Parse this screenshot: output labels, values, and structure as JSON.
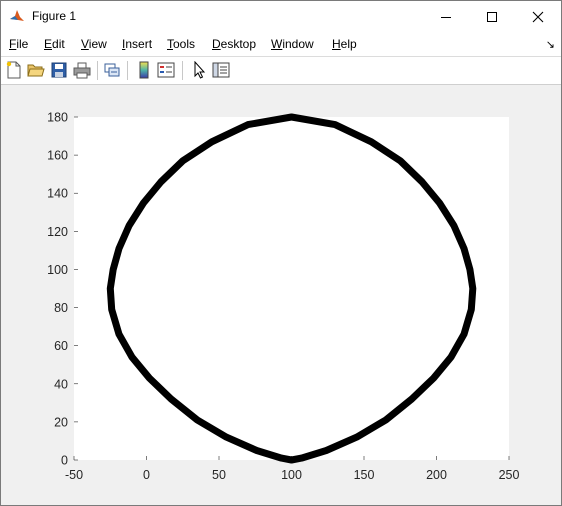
{
  "window": {
    "title": "Figure 1",
    "controls": [
      "minimize",
      "maximize",
      "close"
    ]
  },
  "menubar": {
    "items": [
      {
        "label": "File",
        "mnemonic": "F",
        "rest": "ile"
      },
      {
        "label": "Edit",
        "mnemonic": "E",
        "rest": "dit"
      },
      {
        "label": "View",
        "mnemonic": "V",
        "rest": "iew"
      },
      {
        "label": "Insert",
        "mnemonic": "I",
        "rest": "nsert"
      },
      {
        "label": "Tools",
        "mnemonic": "T",
        "rest": "ools"
      },
      {
        "label": "Desktop",
        "mnemonic": "D",
        "rest": "esktop"
      },
      {
        "label": "Window",
        "mnemonic": "W",
        "rest": "indow"
      },
      {
        "label": "Help",
        "mnemonic": "H",
        "rest": "elp"
      }
    ],
    "dock_glyph": "↘"
  },
  "toolbar": {
    "buttons": [
      "new-figure-icon",
      "open-file-icon",
      "save-figure-icon",
      "print-figure-icon",
      "link-plot-icon",
      "insert-colorbar-icon",
      "insert-legend-icon",
      "edit-plot-pointer-icon",
      "property-inspector-icon"
    ]
  },
  "chart_data": {
    "type": "line",
    "title": "",
    "xlabel": "",
    "ylabel": "",
    "xlim": [
      -50,
      250
    ],
    "ylim": [
      0,
      180
    ],
    "xticks": [
      -50,
      0,
      50,
      100,
      150,
      200,
      250
    ],
    "yticks": [
      0,
      20,
      40,
      60,
      80,
      100,
      120,
      140,
      160,
      180
    ],
    "grid": false,
    "line_color": "#000000",
    "series": [
      {
        "x": [
          100,
          130,
          155,
          175,
          190,
          202,
          212,
          219,
          223,
          225,
          224,
          219,
          210,
          198,
          183,
          165,
          145,
          124,
          107,
          100,
          93,
          76,
          55,
          35,
          17,
          2,
          -10,
          -19,
          -24,
          -25,
          -23,
          -19,
          -12,
          -2,
          10,
          25,
          45,
          70,
          100
        ],
        "y": [
          180,
          176,
          167,
          157,
          146,
          135,
          123,
          111,
          100,
          90,
          79,
          66,
          54,
          43,
          32,
          21,
          12,
          5,
          1,
          0,
          1,
          5,
          12,
          21,
          32,
          43,
          54,
          66,
          79,
          90,
          100,
          111,
          123,
          135,
          146,
          157,
          167,
          176,
          180
        ]
      }
    ]
  }
}
